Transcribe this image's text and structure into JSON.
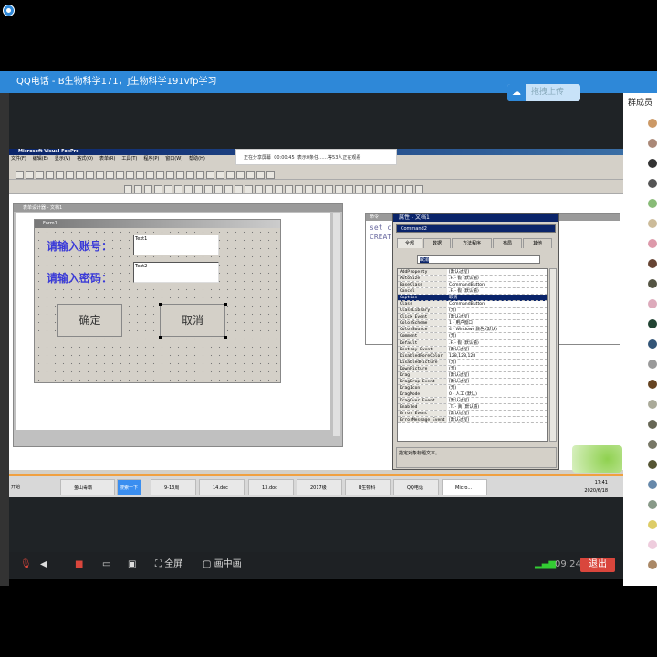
{
  "qq": {
    "title": "QQ电话 - B生物科学171，J生物科学191vfp学习",
    "upload": "拖拽上传",
    "members_title": "群成员"
  },
  "share_notice": {
    "text": "正在分享屏幕",
    "time": "00:00:45",
    "msg": "表示0条任……等53人正在观看"
  },
  "vfp": {
    "title": "Microsoft Visual FoxPro",
    "menu": [
      "文件(F)",
      "编辑(E)",
      "显示(V)",
      "格式(O)",
      "表单(R)",
      "工具(T)",
      "程序(P)",
      "窗口(W)",
      "帮助(H)"
    ],
    "designer_title": "表单设计器 - 文档1",
    "form_title": "Form1",
    "label1": "请输入账号：",
    "label2": "请输入密码：",
    "text1": "Text1",
    "text2": "Text2",
    "ok": "确定",
    "cancel": "取消",
    "cmd_title": "命令",
    "cmd_lines": "set c\nCREAT",
    "props_title": "属性 - 文档1",
    "object": "Command2",
    "tabs": [
      "全部",
      "数据",
      "方法程序",
      "布局",
      "其他"
    ],
    "edit_value": "取消",
    "properties": [
      [
        "AddProperty",
        "[默认过程]"
      ],
      [
        "AutoSize",
        ".F. - 假 (默认值)"
      ],
      [
        "BaseClass",
        "CommandButton"
      ],
      [
        "Cancel",
        ".F. - 假 (默认值)"
      ],
      [
        "Caption",
        "取消"
      ],
      [
        "Class",
        "CommandButton"
      ],
      [
        "ClassLibrary",
        "(无)"
      ],
      [
        "Click Event",
        "[默认过程]"
      ],
      [
        "ColorScheme",
        "1 - 用户窗口"
      ],
      [
        "ColorSource",
        "4 - Windows 颜色 (默认)"
      ],
      [
        "Comment",
        "(无)"
      ],
      [
        "Default",
        ".F. - 假 (默认值)"
      ],
      [
        "Destroy Event",
        "[默认过程]"
      ],
      [
        "DisabledForeColor",
        "128,128,128"
      ],
      [
        "DisabledPicture",
        "(无)"
      ],
      [
        "DownPicture",
        "(无)"
      ],
      [
        "Drag",
        "[默认过程]"
      ],
      [
        "DragDrop Event",
        "[默认过程]"
      ],
      [
        "DragIcon",
        "(无)"
      ],
      [
        "DragMode",
        "0 - 人工 (默认)"
      ],
      [
        "DragOver Event",
        "[默认过程]"
      ],
      [
        "Enabled",
        ".T. - 真 (默认值)"
      ],
      [
        "Error Event",
        "[默认过程]"
      ],
      [
        "ErrorMessage Event",
        "[默认过程]"
      ]
    ],
    "selected_property": "Caption",
    "prop_desc": "指定对象标题文本。"
  },
  "taskbar": {
    "start": "开始",
    "items": [
      "金山毒霸",
      "搜索一下",
      "9-13周",
      "14.doc",
      "13.doc",
      "2017级",
      "B生物科",
      "QQ电话",
      "Micro..."
    ],
    "clock": "17:41",
    "date": "2020/6/18"
  },
  "controls": {
    "fullscreen": "全屏",
    "pip": "画中画",
    "duration": "09:24",
    "exit": "退出"
  }
}
